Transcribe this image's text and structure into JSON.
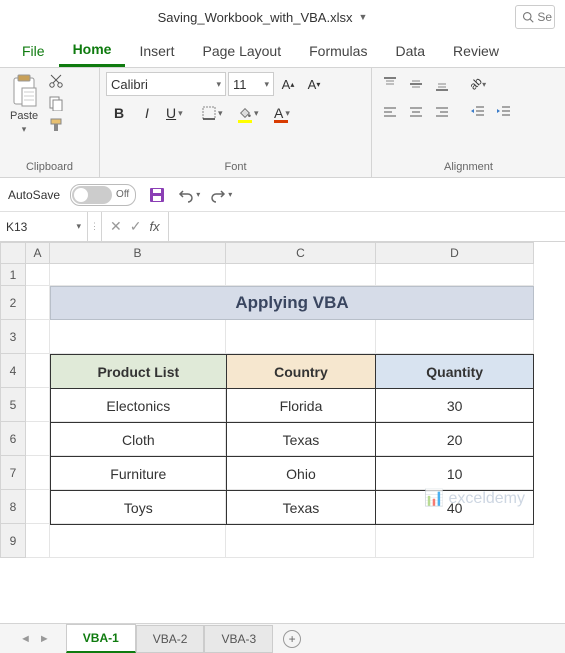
{
  "titlebar": {
    "filename": "Saving_Workbook_with_VBA.xlsx"
  },
  "ribbon": {
    "tabs": {
      "file": "File",
      "home": "Home",
      "insert": "Insert",
      "pagelayout": "Page Layout",
      "formulas": "Formulas",
      "data": "Data",
      "review": "Review"
    },
    "clipboard": {
      "paste": "Paste",
      "group": "Clipboard"
    },
    "font": {
      "name": "Calibri",
      "size": "11",
      "group": "Font"
    },
    "alignment": {
      "group": "Alignment"
    }
  },
  "qat": {
    "autosave": "AutoSave",
    "off": "Off"
  },
  "formulabar": {
    "cellref": "K13",
    "fx": "fx"
  },
  "columns": {
    "A": "A",
    "B": "B",
    "C": "C",
    "D": "D"
  },
  "rows": [
    "1",
    "2",
    "3",
    "4",
    "5",
    "6",
    "7",
    "8",
    "9"
  ],
  "sheet": {
    "banner": "Applying VBA",
    "headers": {
      "product": "Product List",
      "country": "Country",
      "qty": "Quantity"
    },
    "data": [
      {
        "product": "Electonics",
        "country": "Florida",
        "qty": "30"
      },
      {
        "product": "Cloth",
        "country": "Texas",
        "qty": "20"
      },
      {
        "product": "Furniture",
        "country": "Ohio",
        "qty": "10"
      },
      {
        "product": "Toys",
        "country": "Texas",
        "qty": "40"
      }
    ]
  },
  "watermark": "exceldemy",
  "sheettabs": {
    "t1": "VBA-1",
    "t2": "VBA-2",
    "t3": "VBA-3"
  }
}
